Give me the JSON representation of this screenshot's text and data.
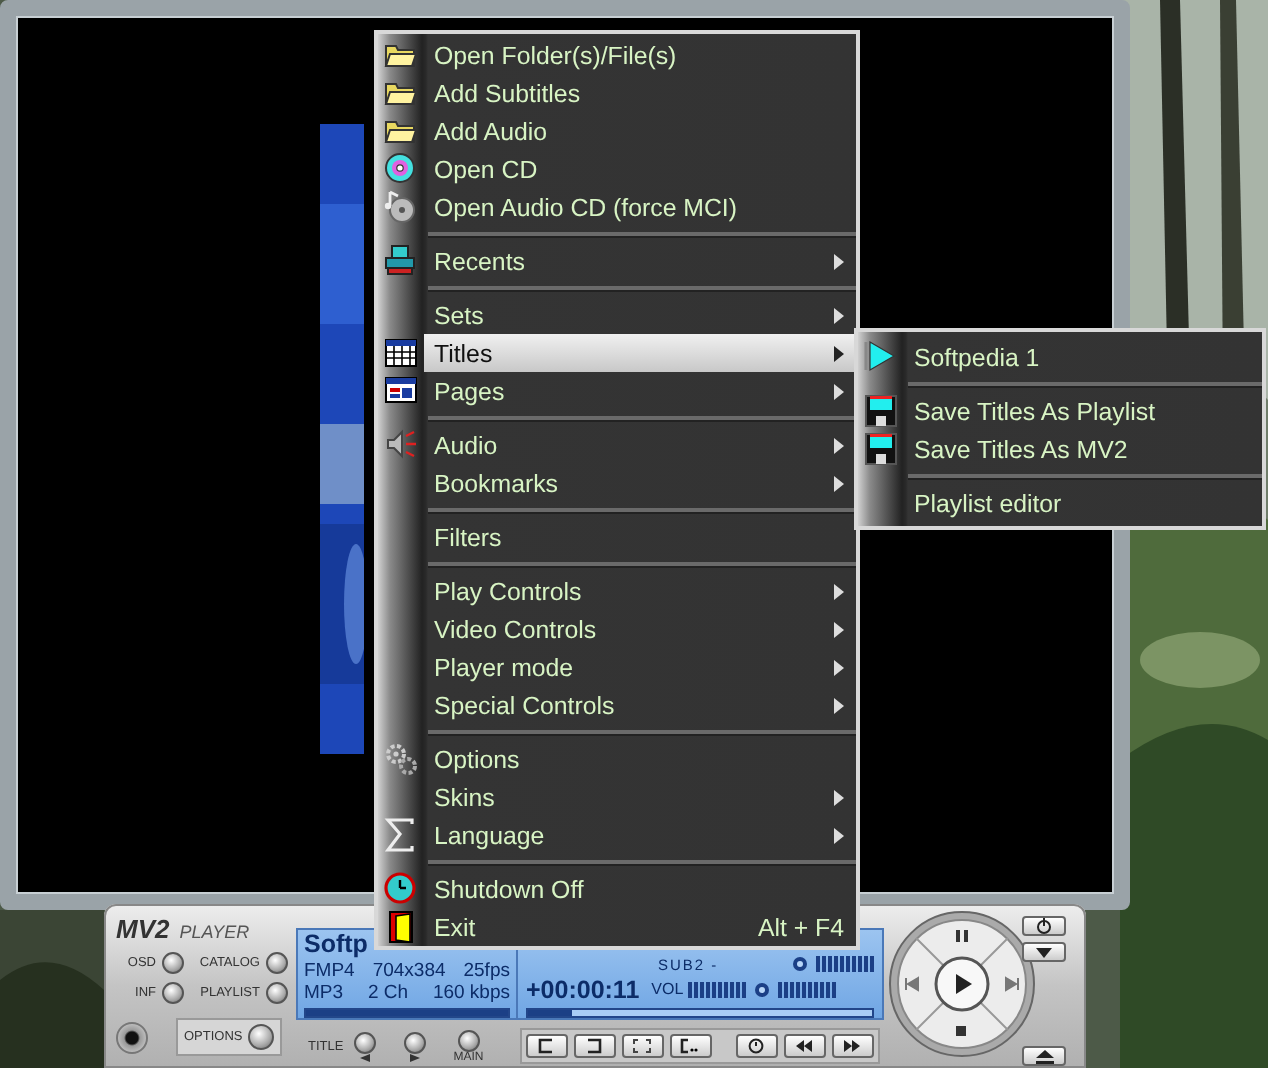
{
  "menu": {
    "items": [
      {
        "kind": "item",
        "label": "Open Folder(s)/File(s)",
        "submenu": false,
        "selected": false
      },
      {
        "kind": "item",
        "label": "Add Subtitles",
        "submenu": false,
        "selected": false
      },
      {
        "kind": "item",
        "label": "Add Audio",
        "submenu": false,
        "selected": false
      },
      {
        "kind": "item",
        "label": "Open CD",
        "submenu": false,
        "selected": false
      },
      {
        "kind": "item",
        "label": "Open Audio CD (force MCI)",
        "submenu": false,
        "selected": false
      },
      {
        "kind": "separator"
      },
      {
        "kind": "item",
        "label": "Recents",
        "submenu": true,
        "selected": false
      },
      {
        "kind": "separator"
      },
      {
        "kind": "item",
        "label": "Sets",
        "submenu": true,
        "selected": false
      },
      {
        "kind": "item",
        "label": "Titles",
        "submenu": true,
        "selected": true
      },
      {
        "kind": "item",
        "label": "Pages",
        "submenu": true,
        "selected": false
      },
      {
        "kind": "separator"
      },
      {
        "kind": "item",
        "label": "Audio",
        "submenu": true,
        "selected": false
      },
      {
        "kind": "item",
        "label": "Bookmarks",
        "submenu": true,
        "selected": false
      },
      {
        "kind": "separator"
      },
      {
        "kind": "item",
        "label": "Filters",
        "submenu": false,
        "selected": false
      },
      {
        "kind": "separator"
      },
      {
        "kind": "item",
        "label": "Play Controls",
        "submenu": true,
        "selected": false
      },
      {
        "kind": "item",
        "label": "Video Controls",
        "submenu": true,
        "selected": false
      },
      {
        "kind": "item",
        "label": "Player mode",
        "submenu": true,
        "selected": false
      },
      {
        "kind": "item",
        "label": "Special Controls",
        "submenu": true,
        "selected": false
      },
      {
        "kind": "separator"
      },
      {
        "kind": "item",
        "label": "Options",
        "submenu": false,
        "selected": false
      },
      {
        "kind": "item",
        "label": "Skins",
        "submenu": true,
        "selected": false
      },
      {
        "kind": "item",
        "label": "Language",
        "submenu": true,
        "selected": false
      },
      {
        "kind": "separator"
      },
      {
        "kind": "item",
        "label": "Shutdown Off",
        "submenu": false,
        "selected": false
      },
      {
        "kind": "item",
        "label": "Exit",
        "submenu": false,
        "selected": false,
        "shortcut": "Alt + F4"
      }
    ]
  },
  "submenu": {
    "items": [
      {
        "kind": "item",
        "label": "Softpedia 1",
        "selected": false
      },
      {
        "kind": "separator"
      },
      {
        "kind": "item",
        "label": "Save Titles As Playlist",
        "selected": false
      },
      {
        "kind": "item",
        "label": "Save Titles As MV2",
        "selected": false
      },
      {
        "kind": "separator"
      },
      {
        "kind": "item",
        "label": "Playlist editor",
        "selected": false
      }
    ]
  },
  "player": {
    "logo": "MV2",
    "logo_sub": "PLAYER",
    "buttons": [
      {
        "label": "OSD"
      },
      {
        "label": "CATALOG"
      },
      {
        "label": "INF"
      },
      {
        "label": "PLAYLIST"
      }
    ],
    "options_button": "OPTIONS",
    "lcd": {
      "title": "Softp",
      "rows": [
        [
          "FMP4",
          "704x384",
          "25fps"
        ],
        [
          "MP3",
          "2 Ch",
          "160 kbps"
        ]
      ],
      "position": {
        "level": 1
      },
      "sub_label": "SUB2 -",
      "time": "+00:00:11",
      "vol_label": "VOL",
      "meters": [
        {
          "level": 1
        },
        {
          "level": 1
        },
        {
          "level": 1
        }
      ],
      "seek": {
        "level": 0.13
      }
    },
    "title_label": "TITLE",
    "main_label": "MAIN"
  }
}
